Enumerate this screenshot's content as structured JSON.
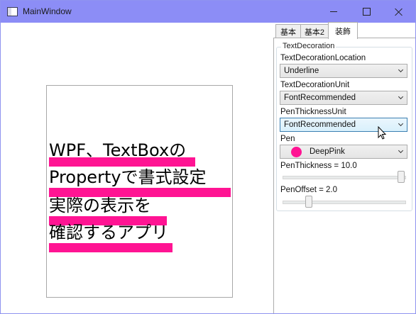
{
  "window": {
    "title": "MainWindow"
  },
  "textbox": {
    "lines": [
      "WPF、TextBoxの",
      "Propertyで書式設定",
      "実際の表示を",
      "確認するアプリ"
    ]
  },
  "tabs": [
    {
      "label": "基本",
      "active": false
    },
    {
      "label": "基本2",
      "active": false
    },
    {
      "label": "装飾",
      "active": true
    }
  ],
  "group": {
    "header": "TextDecoration",
    "location": {
      "label": "TextDecorationLocation",
      "value": "Underline"
    },
    "unit": {
      "label": "TextDecorationUnit",
      "value": "FontRecommended"
    },
    "pen_unit": {
      "label": "PenThicknessUnit",
      "value": "FontRecommended"
    },
    "pen": {
      "label": "Pen",
      "value": "DeepPink",
      "color": "#ff1493"
    },
    "thickness": {
      "label": "PenThickness = 10.0",
      "value": 10.0,
      "fraction": 1.0
    },
    "offset": {
      "label": "PenOffset = 2.0",
      "value": 2.0,
      "fraction": 0.2
    }
  },
  "colors": {
    "titlebar": "#8c8df6",
    "accent": "#ff1493"
  }
}
